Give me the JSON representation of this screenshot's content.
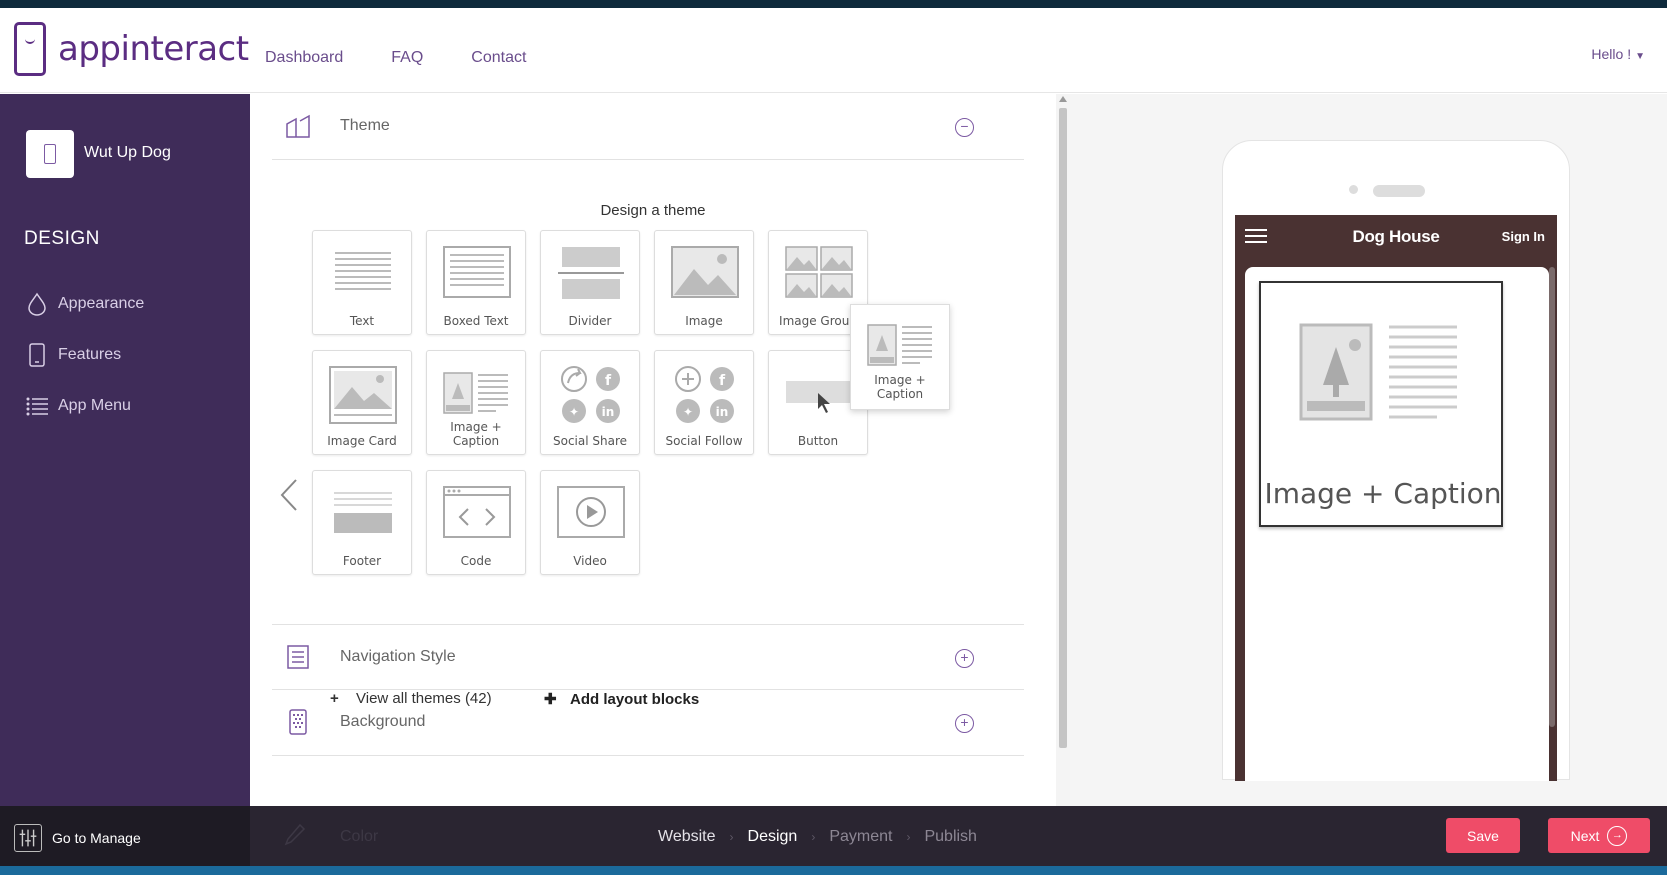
{
  "header": {
    "logo_text": "appinteract",
    "nav": [
      "Dashboard",
      "FAQ",
      "Contact"
    ],
    "greeting": "Hello !"
  },
  "sidebar": {
    "app_name": "Wut Up Dog",
    "section": "DESIGN",
    "items": [
      {
        "label": "Appearance",
        "icon": "drop-icon"
      },
      {
        "label": "Features",
        "icon": "phone-icon"
      },
      {
        "label": "App Menu",
        "icon": "list-icon"
      }
    ],
    "go_to_manage": "Go to Manage"
  },
  "editor": {
    "theme_title": "Theme",
    "design_heading": "Design a theme",
    "tiles": [
      "Text",
      "Boxed Text",
      "Divider",
      "Image",
      "Image Group",
      "Image Card",
      "Image + Caption",
      "Social Share",
      "Social Follow",
      "Button",
      "Footer",
      "Code",
      "Video"
    ],
    "dragging_tile": "Image + Caption",
    "view_all": "View all themes (42)",
    "add_blocks": "Add layout blocks",
    "nav_style_title": "Navigation Style",
    "background_title": "Background",
    "color_title": "Color"
  },
  "preview": {
    "app_title": "Dog House",
    "sign_in": "Sign In",
    "card_caption": "Image + Caption"
  },
  "footer": {
    "steps": [
      "Website",
      "Design",
      "Payment",
      "Publish"
    ],
    "active_step": "Design",
    "save": "Save",
    "next": "Next"
  },
  "colors": {
    "brand_purple": "#5b2d82",
    "sidebar_bg": "#3f2c59",
    "accent_red": "#ef4c68",
    "preview_header": "#4a3232"
  }
}
